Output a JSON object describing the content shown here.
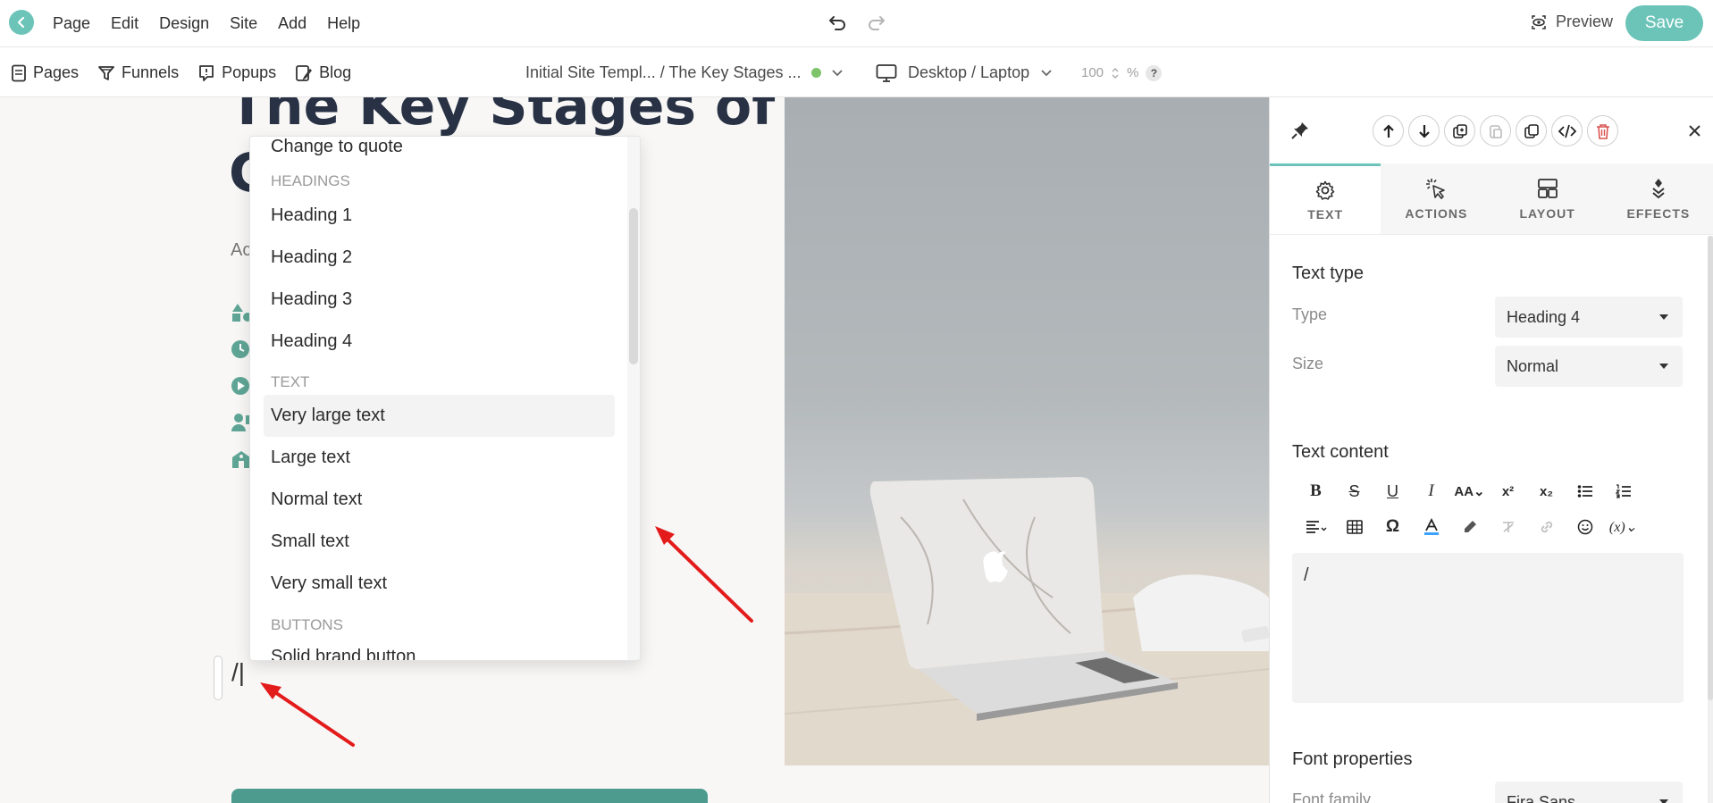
{
  "menubar": {
    "menus": [
      "Page",
      "Edit",
      "Design",
      "Site",
      "Add",
      "Help"
    ],
    "preview_label": "Preview",
    "save_label": "Save"
  },
  "toolbar": {
    "nav": [
      "Pages",
      "Funnels",
      "Popups",
      "Blog"
    ],
    "breadcrumb": "Initial Site Templ... / The Key Stages ...",
    "device": "Desktop / Laptop",
    "zoom_value": "100",
    "zoom_unit": "%",
    "help": "?"
  },
  "canvas": {
    "heading_line1": "The Key Stages of",
    "heading_line2": "C",
    "subtext": "Ac",
    "editing_text": "/|"
  },
  "dropdown": {
    "top_item": "Change to quote",
    "sections": [
      {
        "header": "HEADINGS",
        "items": [
          "Heading 1",
          "Heading 2",
          "Heading 3",
          "Heading 4"
        ]
      },
      {
        "header": "TEXT",
        "items": [
          "Very large text",
          "Large text",
          "Normal text",
          "Small text",
          "Very small text"
        ]
      },
      {
        "header": "BUTTONS",
        "items": [
          "Solid brand button"
        ]
      }
    ],
    "highlighted": "Very large text"
  },
  "panel": {
    "tabs": [
      "TEXT",
      "ACTIONS",
      "LAYOUT",
      "EFFECTS"
    ],
    "active_tab": "TEXT",
    "text_type_title": "Text type",
    "type_label": "Type",
    "type_value": "Heading 4",
    "size_label": "Size",
    "size_value": "Normal",
    "text_content_title": "Text content",
    "content_value": "/",
    "font_properties_title": "Font properties",
    "font_family_label": "Font family",
    "font_family_value": "Fira Sans"
  },
  "colors": {
    "accent": "#6cc4b9",
    "heading": "#283244",
    "feature_icon": "#5fa595",
    "arrow": "#e31b1b",
    "delete": "#d9534f"
  }
}
